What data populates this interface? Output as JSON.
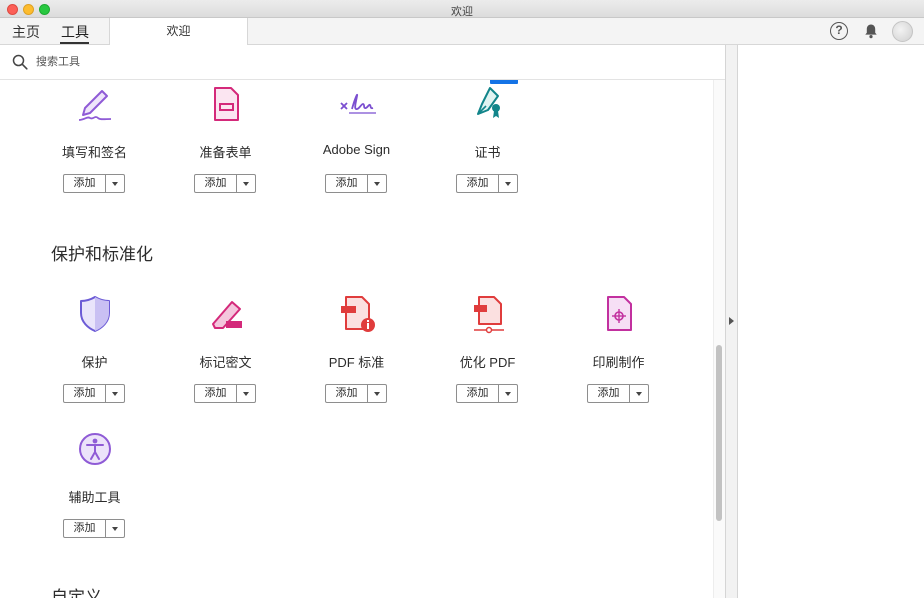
{
  "window": {
    "title": "欢迎"
  },
  "tabs": {
    "home": "主页",
    "tools": "工具",
    "document": "欢迎"
  },
  "header": {
    "help_glyph": "?"
  },
  "search": {
    "placeholder": "搜索工具"
  },
  "add_label": "添加",
  "rows": [
    {
      "items": [
        {
          "label": "填写和签名",
          "icon": "fill-sign-icon"
        },
        {
          "label": "准备表单",
          "icon": "prepare-form-icon"
        },
        {
          "label": "Adobe Sign",
          "icon": "adobe-sign-icon"
        },
        {
          "label": "证书",
          "icon": "certificates-icon"
        }
      ]
    },
    {
      "section": "保护和标准化",
      "items": [
        {
          "label": "保护",
          "icon": "shield-icon"
        },
        {
          "label": "标记密文",
          "icon": "redact-icon"
        },
        {
          "label": "PDF 标准",
          "icon": "pdf-standards-icon"
        },
        {
          "label": "优化 PDF",
          "icon": "optimize-pdf-icon"
        },
        {
          "label": "印刷制作",
          "icon": "print-production-icon"
        }
      ]
    },
    {
      "items": [
        {
          "label": "辅助工具",
          "icon": "accessibility-icon"
        }
      ]
    },
    {
      "section": "自定义",
      "items": []
    }
  ],
  "colors": {
    "purple": "#8f5bd6",
    "pink": "#d4297a",
    "red": "#e03c3c",
    "teal": "#12858a"
  }
}
